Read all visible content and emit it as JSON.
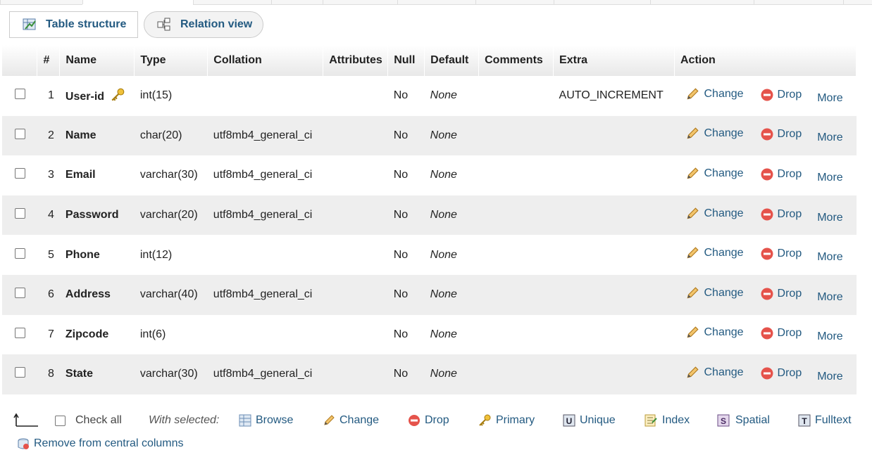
{
  "tabs": [
    {
      "label": "Table structure",
      "icon": "table-structure-icon"
    },
    {
      "label": "Relation view",
      "icon": "relation-view-icon"
    }
  ],
  "table": {
    "headers": [
      "#",
      "Name",
      "Type",
      "Collation",
      "Attributes",
      "Null",
      "Default",
      "Comments",
      "Extra",
      "Action"
    ],
    "rows": [
      {
        "num": "1",
        "name": "User-id",
        "type": "int(15)",
        "collation": "",
        "attributes": "",
        "null": "No",
        "default": "None",
        "comments": "",
        "extra": "AUTO_INCREMENT",
        "primary_key": true
      },
      {
        "num": "2",
        "name": "Name",
        "type": "char(20)",
        "collation": "utf8mb4_general_ci",
        "attributes": "",
        "null": "No",
        "default": "None",
        "comments": "",
        "extra": ""
      },
      {
        "num": "3",
        "name": "Email",
        "type": "varchar(30)",
        "collation": "utf8mb4_general_ci",
        "attributes": "",
        "null": "No",
        "default": "None",
        "comments": "",
        "extra": ""
      },
      {
        "num": "4",
        "name": "Password",
        "type": "varchar(20)",
        "collation": "utf8mb4_general_ci",
        "attributes": "",
        "null": "No",
        "default": "None",
        "comments": "",
        "extra": ""
      },
      {
        "num": "5",
        "name": "Phone",
        "type": "int(12)",
        "collation": "",
        "attributes": "",
        "null": "No",
        "default": "None",
        "comments": "",
        "extra": ""
      },
      {
        "num": "6",
        "name": "Address",
        "type": "varchar(40)",
        "collation": "utf8mb4_general_ci",
        "attributes": "",
        "null": "No",
        "default": "None",
        "comments": "",
        "extra": ""
      },
      {
        "num": "7",
        "name": "Zipcode",
        "type": "int(6)",
        "collation": "",
        "attributes": "",
        "null": "No",
        "default": "None",
        "comments": "",
        "extra": ""
      },
      {
        "num": "8",
        "name": "State",
        "type": "varchar(30)",
        "collation": "utf8mb4_general_ci",
        "attributes": "",
        "null": "No",
        "default": "None",
        "comments": "",
        "extra": ""
      }
    ],
    "actions": {
      "change": "Change",
      "drop": "Drop",
      "more": "More"
    }
  },
  "footer": {
    "check_all": "Check all",
    "with_selected": "With selected:",
    "browse": "Browse",
    "change": "Change",
    "drop": "Drop",
    "primary": "Primary",
    "unique": "Unique",
    "index": "Index",
    "spatial": "Spatial",
    "fulltext": "Fulltext",
    "remove_central": "Remove from central columns"
  },
  "colors": {
    "link": "#235a81",
    "drop": "#e5534b",
    "pencil": "#e6a93a",
    "key": "#e8b52a"
  }
}
